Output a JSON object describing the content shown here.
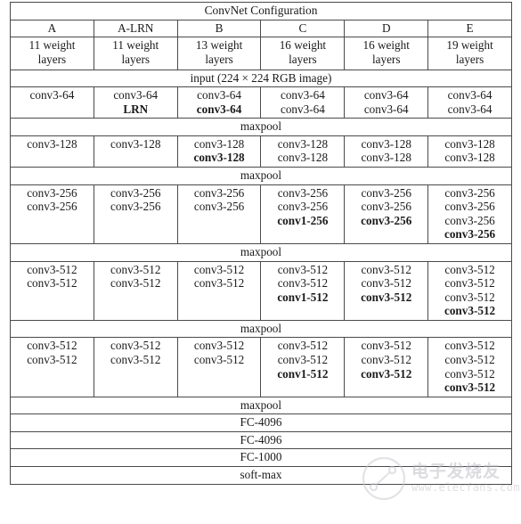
{
  "table": {
    "title": "ConvNet Configuration",
    "input_row": "input (224 × 224 RGB image)",
    "maxpool_label": "maxpool",
    "configs": [
      {
        "name": "A",
        "layers_line1": "11 weight",
        "layers_line2": "layers"
      },
      {
        "name": "A-LRN",
        "layers_line1": "11 weight",
        "layers_line2": "layers"
      },
      {
        "name": "B",
        "layers_line1": "13 weight",
        "layers_line2": "layers"
      },
      {
        "name": "C",
        "layers_line1": "16 weight",
        "layers_line2": "layers"
      },
      {
        "name": "D",
        "layers_line1": "16 weight",
        "layers_line2": "layers"
      },
      {
        "name": "E",
        "layers_line1": "19 weight",
        "layers_line2": "layers"
      }
    ],
    "blocks": [
      {
        "id": "block-64",
        "rows": 2,
        "columns": [
          [
            {
              "text": "conv3-64",
              "bold": false
            }
          ],
          [
            {
              "text": "conv3-64",
              "bold": false
            },
            {
              "text": "LRN",
              "bold": true
            }
          ],
          [
            {
              "text": "conv3-64",
              "bold": false
            },
            {
              "text": "conv3-64",
              "bold": true
            }
          ],
          [
            {
              "text": "conv3-64",
              "bold": false
            },
            {
              "text": "conv3-64",
              "bold": false
            }
          ],
          [
            {
              "text": "conv3-64",
              "bold": false
            },
            {
              "text": "conv3-64",
              "bold": false
            }
          ],
          [
            {
              "text": "conv3-64",
              "bold": false
            },
            {
              "text": "conv3-64",
              "bold": false
            }
          ]
        ]
      },
      {
        "id": "block-128",
        "rows": 2,
        "columns": [
          [
            {
              "text": "conv3-128",
              "bold": false
            }
          ],
          [
            {
              "text": "conv3-128",
              "bold": false
            }
          ],
          [
            {
              "text": "conv3-128",
              "bold": false
            },
            {
              "text": "conv3-128",
              "bold": true
            }
          ],
          [
            {
              "text": "conv3-128",
              "bold": false
            },
            {
              "text": "conv3-128",
              "bold": false
            }
          ],
          [
            {
              "text": "conv3-128",
              "bold": false
            },
            {
              "text": "conv3-128",
              "bold": false
            }
          ],
          [
            {
              "text": "conv3-128",
              "bold": false
            },
            {
              "text": "conv3-128",
              "bold": false
            }
          ]
        ]
      },
      {
        "id": "block-256",
        "rows": 4,
        "columns": [
          [
            {
              "text": "conv3-256",
              "bold": false
            },
            {
              "text": "conv3-256",
              "bold": false
            }
          ],
          [
            {
              "text": "conv3-256",
              "bold": false
            },
            {
              "text": "conv3-256",
              "bold": false
            }
          ],
          [
            {
              "text": "conv3-256",
              "bold": false
            },
            {
              "text": "conv3-256",
              "bold": false
            }
          ],
          [
            {
              "text": "conv3-256",
              "bold": false
            },
            {
              "text": "conv3-256",
              "bold": false
            },
            {
              "text": "conv1-256",
              "bold": true
            }
          ],
          [
            {
              "text": "conv3-256",
              "bold": false
            },
            {
              "text": "conv3-256",
              "bold": false
            },
            {
              "text": "conv3-256",
              "bold": true
            }
          ],
          [
            {
              "text": "conv3-256",
              "bold": false
            },
            {
              "text": "conv3-256",
              "bold": false
            },
            {
              "text": "conv3-256",
              "bold": false
            },
            {
              "text": "conv3-256",
              "bold": true
            }
          ]
        ]
      },
      {
        "id": "block-512-a",
        "rows": 4,
        "columns": [
          [
            {
              "text": "conv3-512",
              "bold": false
            },
            {
              "text": "conv3-512",
              "bold": false
            }
          ],
          [
            {
              "text": "conv3-512",
              "bold": false
            },
            {
              "text": "conv3-512",
              "bold": false
            }
          ],
          [
            {
              "text": "conv3-512",
              "bold": false
            },
            {
              "text": "conv3-512",
              "bold": false
            }
          ],
          [
            {
              "text": "conv3-512",
              "bold": false
            },
            {
              "text": "conv3-512",
              "bold": false
            },
            {
              "text": "conv1-512",
              "bold": true
            }
          ],
          [
            {
              "text": "conv3-512",
              "bold": false
            },
            {
              "text": "conv3-512",
              "bold": false
            },
            {
              "text": "conv3-512",
              "bold": true
            }
          ],
          [
            {
              "text": "conv3-512",
              "bold": false
            },
            {
              "text": "conv3-512",
              "bold": false
            },
            {
              "text": "conv3-512",
              "bold": false
            },
            {
              "text": "conv3-512",
              "bold": true
            }
          ]
        ]
      },
      {
        "id": "block-512-b",
        "rows": 4,
        "columns": [
          [
            {
              "text": "conv3-512",
              "bold": false
            },
            {
              "text": "conv3-512",
              "bold": false
            }
          ],
          [
            {
              "text": "conv3-512",
              "bold": false
            },
            {
              "text": "conv3-512",
              "bold": false
            }
          ],
          [
            {
              "text": "conv3-512",
              "bold": false
            },
            {
              "text": "conv3-512",
              "bold": false
            }
          ],
          [
            {
              "text": "conv3-512",
              "bold": false
            },
            {
              "text": "conv3-512",
              "bold": false
            },
            {
              "text": "conv1-512",
              "bold": true
            }
          ],
          [
            {
              "text": "conv3-512",
              "bold": false
            },
            {
              "text": "conv3-512",
              "bold": false
            },
            {
              "text": "conv3-512",
              "bold": true
            }
          ],
          [
            {
              "text": "conv3-512",
              "bold": false
            },
            {
              "text": "conv3-512",
              "bold": false
            },
            {
              "text": "conv3-512",
              "bold": false
            },
            {
              "text": "conv3-512",
              "bold": true
            }
          ]
        ]
      }
    ],
    "footer_rows": [
      "maxpool",
      "FC-4096",
      "FC-4096",
      "FC-1000",
      "soft-max"
    ]
  },
  "watermark": {
    "brand_cn": "电子发烧友",
    "url": "www.elecfans.com"
  }
}
